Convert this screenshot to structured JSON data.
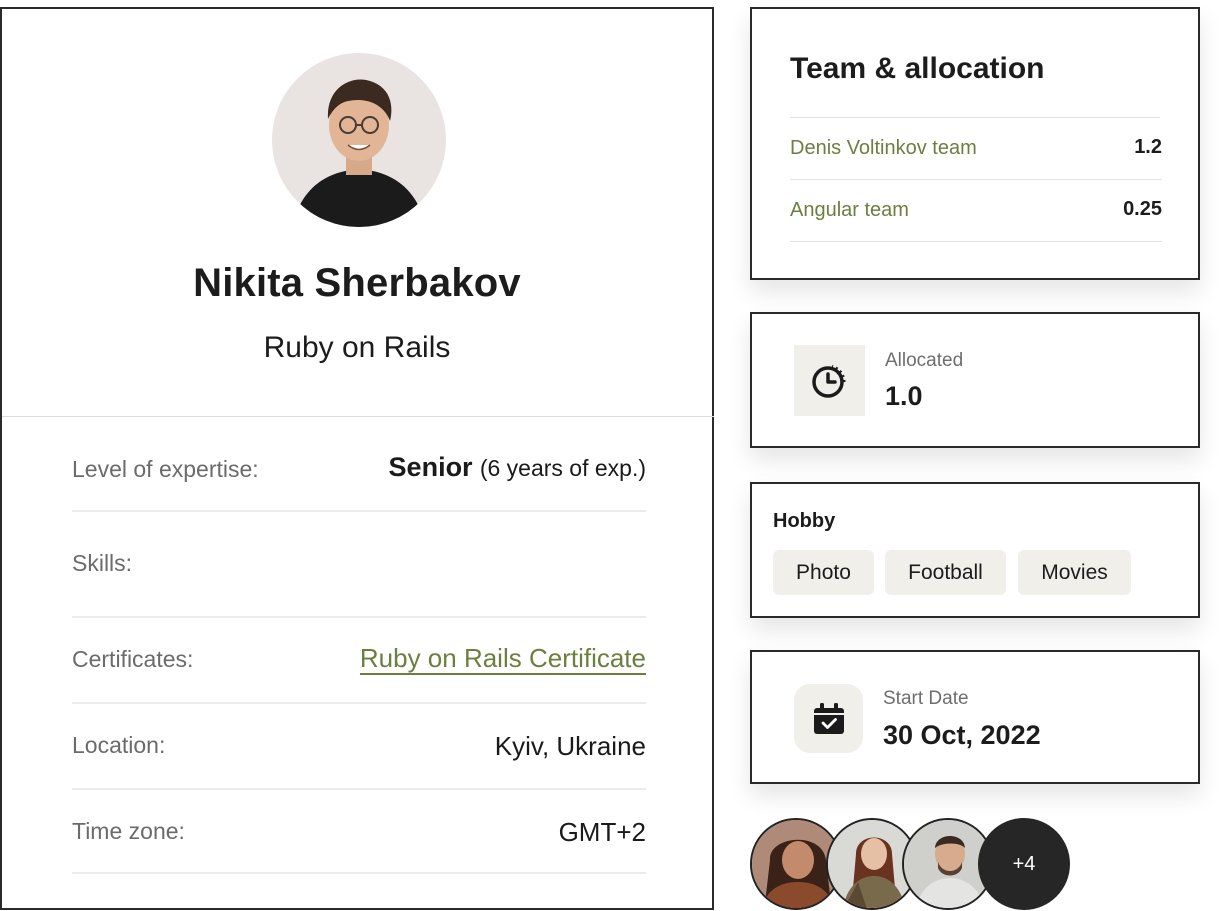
{
  "profile": {
    "name": "Nikita Sherbakov",
    "role": "Ruby on Rails",
    "details": [
      {
        "label": "Level of expertise:",
        "value": "Senior",
        "value_sub": "(6 years of exp.)"
      },
      {
        "label": "Skills:",
        "value": ""
      },
      {
        "label": "Certificates:",
        "value": "Ruby on Rails Certificate"
      },
      {
        "label": "Location:",
        "value": "Kyiv, Ukraine"
      },
      {
        "label": "Time zone:",
        "value": "GMT+2"
      }
    ]
  },
  "team": {
    "title": "Team & allocation",
    "rows": [
      {
        "name": "Denis Voltinkov team",
        "value": "1.2"
      },
      {
        "name": "Angular team",
        "value": "0.25"
      }
    ]
  },
  "allocated": {
    "label": "Allocated",
    "value": "1.0",
    "icon": "clock-icon"
  },
  "hobby": {
    "title": "Hobby",
    "items": [
      "Photo",
      "Football",
      "Movies"
    ]
  },
  "start_date": {
    "label": "Start Date",
    "value": "30 Oct, 2022",
    "icon": "calendar-check-icon"
  },
  "members": {
    "more_label": "+4"
  },
  "colors": {
    "accent": "#6b7f3f",
    "chip_bg": "#f0efea",
    "border": "#2a2a2a"
  }
}
